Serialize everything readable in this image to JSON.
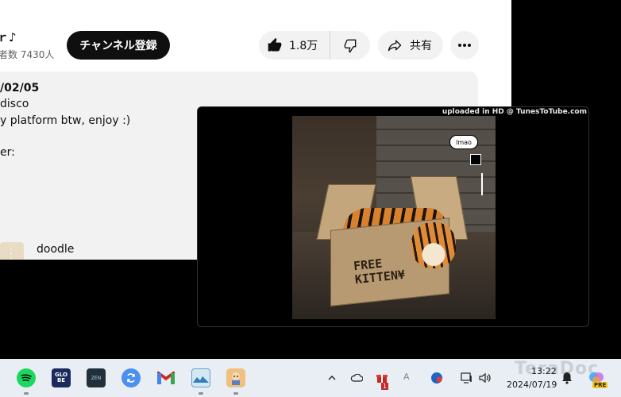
{
  "channel": {
    "name_partial": "ｒ♪",
    "subscribers_partial": "者数 7430人",
    "subscribe_label": "チャンネル登録"
  },
  "actions": {
    "like_count": "1.8万",
    "share_label": "共有"
  },
  "description": {
    "date_partial": "/02/05",
    "line1": "disco",
    "line2": "y platform btw, enjoy :)",
    "line3": "er:",
    "chapter_label": "doodle"
  },
  "miniplayer": {
    "watermark": "uploaded in HD @ TunesToTube.com",
    "bubble_text": "lmao",
    "box_text_line1": "FREE",
    "box_text_line2": "KITTEN¥"
  },
  "taskbar": {
    "apps": [
      "spotify",
      "globe-app",
      "dark-app",
      "sync-app",
      "gmail",
      "photos-app",
      "avatar-app"
    ],
    "globe_text": "GLO BE",
    "dark_app_text": "ZEN",
    "time": "13:22",
    "date": "2024/07/19",
    "ime_indicator": "A",
    "badge": "1",
    "pre_badge": "PRE",
    "brand_watermark": "TeraDoc"
  },
  "colors": {
    "subscribe_bg": "#0f0f0f",
    "pill_bg": "#f2f2f2",
    "taskbar_bg": "#e9eef4",
    "spotify": "#1ed760"
  }
}
